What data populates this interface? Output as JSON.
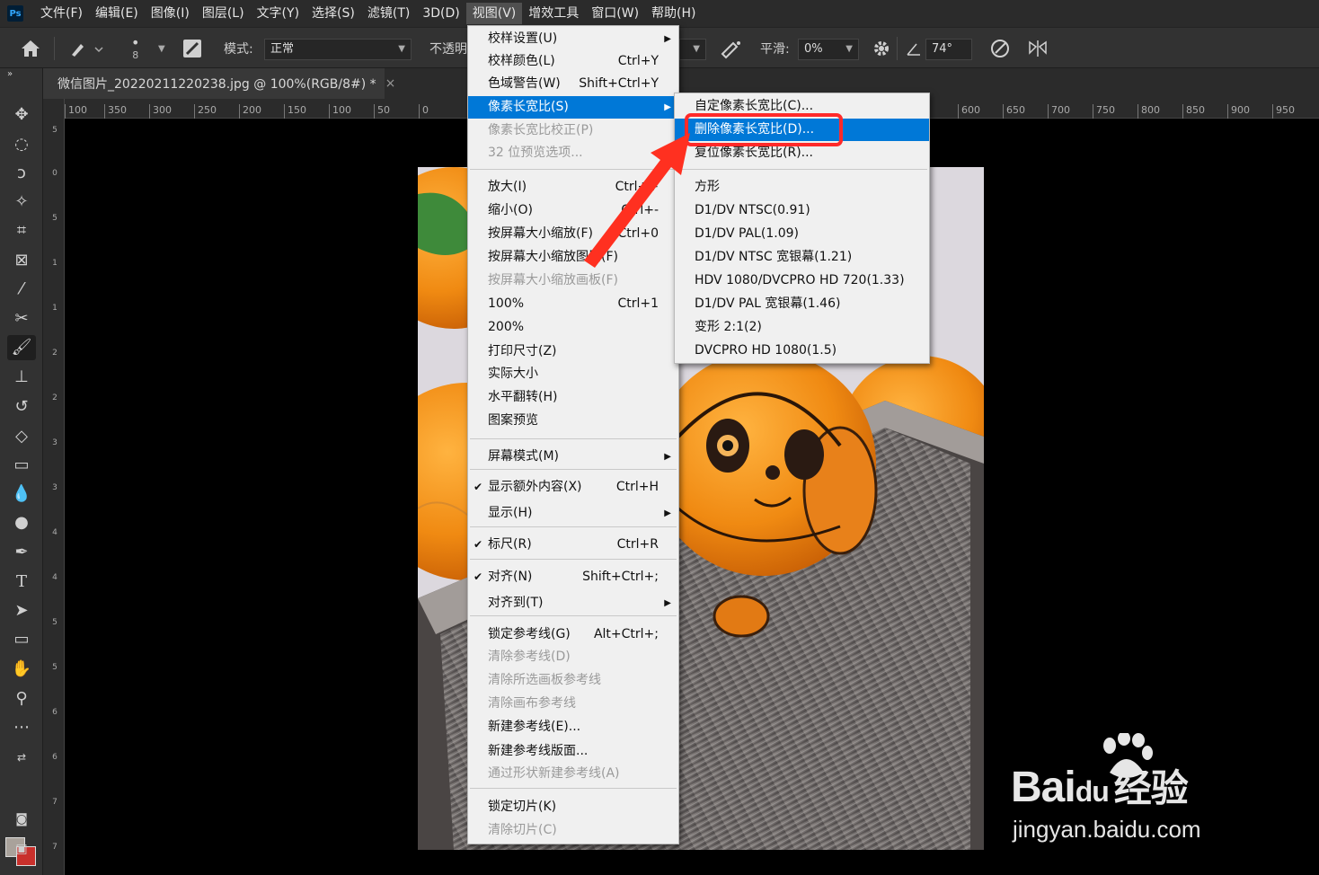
{
  "app": {
    "logo": "Ps",
    "menus": [
      "文件(F)",
      "编辑(E)",
      "图像(I)",
      "图层(L)",
      "文字(Y)",
      "选择(S)",
      "滤镜(T)",
      "3D(D)",
      "视图(V)",
      "增效工具",
      "窗口(W)",
      "帮助(H)"
    ],
    "active_menu": "视图(V)"
  },
  "options": {
    "brush_size": "8",
    "mode_label": "模式:",
    "mode_value": "正常",
    "opacity_label": "不透明",
    "smooth_label": "平滑:",
    "smooth_value": "0%",
    "angle_value": "74°"
  },
  "document": {
    "tab_title": "微信图片_20220211220238.jpg @ 100%(RGB/8#) *",
    "close": "×"
  },
  "ruler": {
    "top": [
      "100",
      "350",
      "300",
      "250",
      "200",
      "150",
      "100",
      "50",
      "0",
      "600",
      "650",
      "700",
      "750",
      "800",
      "850",
      "900",
      "950"
    ],
    "left": [
      "5",
      "0",
      "5",
      "1",
      "1",
      "2",
      "2",
      "3",
      "3",
      "4",
      "4",
      "5",
      "5",
      "6",
      "6",
      "7",
      "7"
    ]
  },
  "view_menu": {
    "items": [
      {
        "label": "校样设置(U)",
        "shortcut": "",
        "submenu": true,
        "disabled": false
      },
      {
        "label": "校样颜色(L)",
        "shortcut": "Ctrl+Y",
        "submenu": false,
        "disabled": false
      },
      {
        "label": "色域警告(W)",
        "shortcut": "Shift+Ctrl+Y",
        "submenu": false,
        "disabled": false
      },
      {
        "label": "像素长宽比(S)",
        "shortcut": "",
        "submenu": true,
        "disabled": false
      },
      {
        "label": "像素长宽比校正(P)",
        "shortcut": "",
        "submenu": false,
        "disabled": true
      },
      {
        "label": "32 位预览选项...",
        "shortcut": "",
        "submenu": false,
        "disabled": true
      },
      {
        "label": "放大(I)",
        "shortcut": "Ctrl++",
        "submenu": false,
        "disabled": false
      },
      {
        "label": "缩小(O)",
        "shortcut": "Ctrl+-",
        "submenu": false,
        "disabled": false
      },
      {
        "label": "按屏幕大小缩放(F)",
        "shortcut": "Ctrl+0",
        "submenu": false,
        "disabled": false
      },
      {
        "label": "按屏幕大小缩放图层(F)",
        "shortcut": "",
        "submenu": false,
        "disabled": false
      },
      {
        "label": "按屏幕大小缩放画板(F)",
        "shortcut": "",
        "submenu": false,
        "disabled": true
      },
      {
        "label": "100%",
        "shortcut": "Ctrl+1",
        "submenu": false,
        "disabled": false
      },
      {
        "label": "200%",
        "shortcut": "",
        "submenu": false,
        "disabled": false
      },
      {
        "label": "打印尺寸(Z)",
        "shortcut": "",
        "submenu": false,
        "disabled": false
      },
      {
        "label": "实际大小",
        "shortcut": "",
        "submenu": false,
        "disabled": false
      },
      {
        "label": "水平翻转(H)",
        "shortcut": "",
        "submenu": false,
        "disabled": false
      },
      {
        "label": "图案预览",
        "shortcut": "",
        "submenu": false,
        "disabled": false
      },
      {
        "label": "屏幕模式(M)",
        "shortcut": "",
        "submenu": true,
        "disabled": false
      },
      {
        "label": "显示额外内容(X)",
        "shortcut": "Ctrl+H",
        "submenu": false,
        "disabled": false,
        "checked": true
      },
      {
        "label": "显示(H)",
        "shortcut": "",
        "submenu": true,
        "disabled": false
      },
      {
        "label": "标尺(R)",
        "shortcut": "Ctrl+R",
        "submenu": false,
        "disabled": false,
        "checked": true
      },
      {
        "label": "对齐(N)",
        "shortcut": "Shift+Ctrl+;",
        "submenu": false,
        "disabled": false,
        "checked": true
      },
      {
        "label": "对齐到(T)",
        "shortcut": "",
        "submenu": true,
        "disabled": false
      },
      {
        "label": "锁定参考线(G)",
        "shortcut": "Alt+Ctrl+;",
        "submenu": false,
        "disabled": false
      },
      {
        "label": "清除参考线(D)",
        "shortcut": "",
        "submenu": false,
        "disabled": true
      },
      {
        "label": "清除所选画板参考线",
        "shortcut": "",
        "submenu": false,
        "disabled": true
      },
      {
        "label": "清除画布参考线",
        "shortcut": "",
        "submenu": false,
        "disabled": true
      },
      {
        "label": "新建参考线(E)...",
        "shortcut": "",
        "submenu": false,
        "disabled": false
      },
      {
        "label": "新建参考线版面...",
        "shortcut": "",
        "submenu": false,
        "disabled": false
      },
      {
        "label": "通过形状新建参考线(A)",
        "shortcut": "",
        "submenu": false,
        "disabled": true
      },
      {
        "label": "锁定切片(K)",
        "shortcut": "",
        "submenu": false,
        "disabled": false
      },
      {
        "label": "清除切片(C)",
        "shortcut": "",
        "submenu": false,
        "disabled": true
      }
    ]
  },
  "pixel_aspect_submenu": {
    "items": [
      "自定像素长宽比(C)...",
      "删除像素长宽比(D)...",
      "复位像素长宽比(R)...",
      "方形",
      "D1/DV NTSC(0.91)",
      "D1/DV PAL(1.09)",
      "D1/DV NTSC 宽银幕(1.21)",
      "HDV 1080/DVCPRO HD 720(1.33)",
      "D1/DV PAL 宽银幕(1.46)",
      "变形 2:1(2)",
      "DVCPRO HD 1080(1.5)"
    ],
    "highlighted": "删除像素长宽比(D)..."
  },
  "watermark": {
    "brand": "Bai",
    "brand2": "du",
    "cn": "经验",
    "url": "jingyan.baidu.com"
  },
  "colors": {
    "menu_highlight": "#0078d7",
    "annotation_red": "#ff2a2a",
    "foreground": "#a9a29b",
    "background": "#c9302c"
  }
}
